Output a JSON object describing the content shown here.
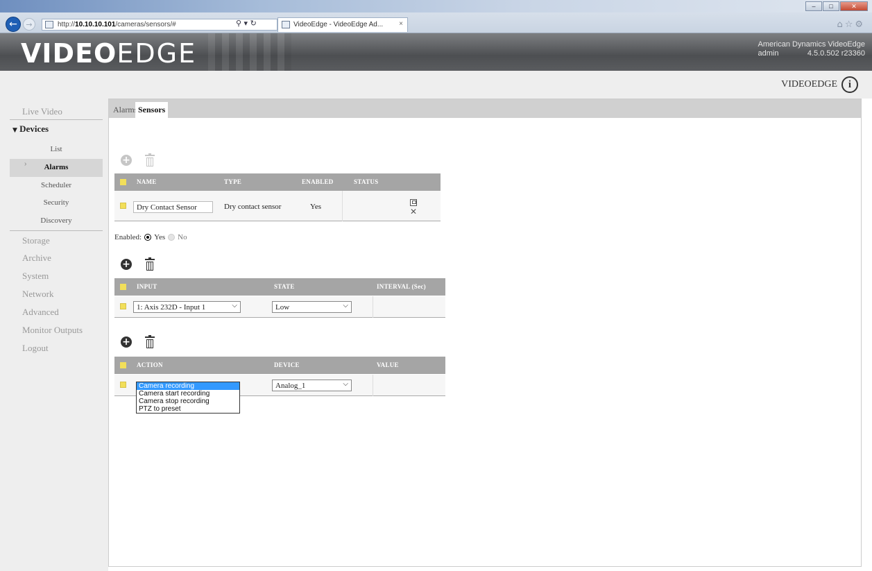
{
  "browser": {
    "url_prefix": "http://",
    "url_host": "10.10.10.101",
    "url_path": "/cameras/sensors/#",
    "addr_tools": "⚲ ▾ ↻",
    "tab_title": "VideoEdge - VideoEdge Ad...",
    "tab_close": "×",
    "back": "←",
    "forward": "→",
    "min": "–",
    "max": "□",
    "close": "✕",
    "chrome_icons": "⌂☆⚙"
  },
  "header": {
    "logo_bold": "VIDEO",
    "logo_light": "EDGE",
    "company": "American Dynamics VideoEdge",
    "user": "admin",
    "version": "4.5.0.502 r23360",
    "product_name": "VIDEOEDGE",
    "info_glyph": "i"
  },
  "sidebar": {
    "live_video": "Live Video",
    "devices": "Devices",
    "devices_arrow": "▼",
    "sub_items": [
      "List",
      "Alarms",
      "Scheduler",
      "Security",
      "Discovery"
    ],
    "active_chevron": "›",
    "items": [
      "Storage",
      "Archive",
      "System",
      "Network",
      "Advanced",
      "Monitor Outputs",
      "Logout"
    ]
  },
  "tabs": [
    "Alarms",
    "Sensors"
  ],
  "toolbar": {
    "add_glyph": "+"
  },
  "sensors_table": {
    "headers": [
      "NAME",
      "TYPE",
      "ENABLED",
      "STATUS"
    ],
    "row": {
      "name": "Dry Contact Sensor",
      "type": "Dry contact sensor",
      "enabled": "Yes",
      "delete_glyph": "✕"
    }
  },
  "enabled_field": {
    "label": "Enabled:",
    "yes": "Yes",
    "no": "No",
    "value": "Yes"
  },
  "input_table": {
    "headers": [
      "INPUT",
      "STATE",
      "INTERVAL (Sec)"
    ],
    "row": {
      "input": "1: Axis 232D - Input 1",
      "state": "Low",
      "arrow": "⌵"
    }
  },
  "action_table": {
    "headers": [
      "ACTION",
      "DEVICE",
      "VALUE"
    ],
    "row": {
      "device": "Analog_1",
      "arrow": "⌵"
    },
    "action_options": [
      "Camera recording",
      "Camera start recording",
      "Camera stop recording",
      "PTZ to preset"
    ],
    "selected_action": "Camera recording"
  }
}
